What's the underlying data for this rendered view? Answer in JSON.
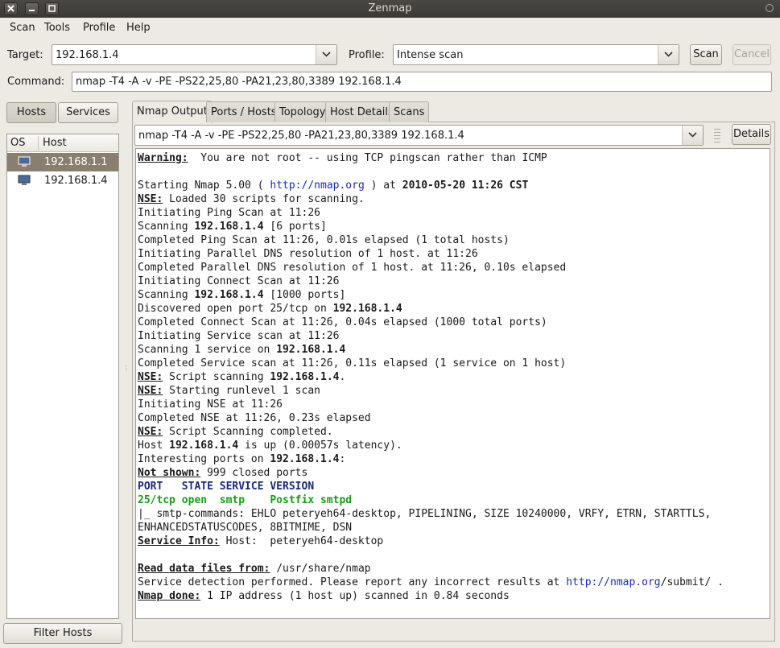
{
  "window": {
    "title": "Zenmap"
  },
  "menu": [
    "Scan",
    "Tools",
    "Profile",
    "Help"
  ],
  "target": {
    "label": "Target:",
    "value": "192.168.1.4"
  },
  "profile": {
    "label": "Profile:",
    "value": "Intense scan"
  },
  "buttons": {
    "scan": "Scan",
    "cancel": "Cancel",
    "details": "Details",
    "hosts": "Hosts",
    "services": "Services",
    "filter_hosts": "Filter Hosts"
  },
  "command": {
    "label": "Command:",
    "value": "nmap -T4 -A -v -PE -PS22,25,80 -PA21,23,80,3389 192.168.1.4"
  },
  "host_list": {
    "columns": [
      "OS",
      "Host"
    ],
    "rows": [
      "192.168.1.1",
      "192.168.1.4"
    ]
  },
  "tabs": [
    "Nmap Output",
    "Ports / Hosts",
    "Topology",
    "Host Details",
    "Scans"
  ],
  "output_selector": "nmap -T4 -A -v -PE -PS22,25,80 -PA21,23,80,3389 192.168.1.4",
  "output": [
    [
      {
        "t": "Warning:",
        "s": "b u"
      },
      {
        "t": "  You are not root -- using TCP pingscan rather than ICMP"
      }
    ],
    [],
    [
      {
        "t": "Starting Nmap 5.00 ( "
      },
      {
        "t": "http://nmap.org",
        "s": "link"
      },
      {
        "t": " ) at "
      },
      {
        "t": "2010-05-20 11:26 CST",
        "s": "b"
      }
    ],
    [
      {
        "t": "NSE:",
        "s": "b u"
      },
      {
        "t": " Loaded 30 scripts for scanning."
      }
    ],
    [
      {
        "t": "Initiating Ping Scan at 11:26"
      }
    ],
    [
      {
        "t": "Scanning "
      },
      {
        "t": "192.168.1.4",
        "s": "b"
      },
      {
        "t": " [6 ports]"
      }
    ],
    [
      {
        "t": "Completed Ping Scan at 11:26, 0.01s elapsed (1 total hosts)"
      }
    ],
    [
      {
        "t": "Initiating Parallel DNS resolution of 1 host. at 11:26"
      }
    ],
    [
      {
        "t": "Completed Parallel DNS resolution of 1 host. at 11:26, 0.10s elapsed"
      }
    ],
    [
      {
        "t": "Initiating Connect Scan at 11:26"
      }
    ],
    [
      {
        "t": "Scanning "
      },
      {
        "t": "192.168.1.4",
        "s": "b"
      },
      {
        "t": " [1000 ports]"
      }
    ],
    [
      {
        "t": "Discovered open port 25/tcp on "
      },
      {
        "t": "192.168.1.4",
        "s": "b"
      }
    ],
    [
      {
        "t": "Completed Connect Scan at 11:26, 0.04s elapsed (1000 total ports)"
      }
    ],
    [
      {
        "t": "Initiating Service scan at 11:26"
      }
    ],
    [
      {
        "t": "Scanning 1 service on "
      },
      {
        "t": "192.168.1.4",
        "s": "b"
      }
    ],
    [
      {
        "t": "Completed Service scan at 11:26, 0.11s elapsed (1 service on 1 host)"
      }
    ],
    [
      {
        "t": "NSE:",
        "s": "b u"
      },
      {
        "t": " Script scanning "
      },
      {
        "t": "192.168.1.4",
        "s": "b"
      },
      {
        "t": "."
      }
    ],
    [
      {
        "t": "NSE:",
        "s": "b u"
      },
      {
        "t": " Starting runlevel 1 scan"
      }
    ],
    [
      {
        "t": "Initiating NSE at 11:26"
      }
    ],
    [
      {
        "t": "Completed NSE at 11:26, 0.23s elapsed"
      }
    ],
    [
      {
        "t": "NSE:",
        "s": "b u"
      },
      {
        "t": " Script Scanning completed."
      }
    ],
    [
      {
        "t": "Host "
      },
      {
        "t": "192.168.1.4",
        "s": "b"
      },
      {
        "t": " is up (0.00057s latency)."
      }
    ],
    [
      {
        "t": "Interesting ports on "
      },
      {
        "t": "192.168.1.4",
        "s": "b"
      },
      {
        "t": ":"
      }
    ],
    [
      {
        "t": "Not shown:",
        "s": "b u"
      },
      {
        "t": " 999 closed ports"
      }
    ],
    [
      {
        "t": "PORT   STATE SERVICE VERSION",
        "s": "navy"
      }
    ],
    [
      {
        "t": "25/tcp open  smtp    Postfix smtpd",
        "s": "green"
      }
    ],
    [
      {
        "t": "|_ smtp-commands: EHLO peteryeh64-desktop, PIPELINING, SIZE 10240000, VRFY, ETRN, STARTTLS,"
      }
    ],
    [
      {
        "t": "ENHANCEDSTATUSCODES, 8BITMIME, DSN"
      }
    ],
    [
      {
        "t": "Service Info:",
        "s": "b u"
      },
      {
        "t": " Host:  peteryeh64-desktop"
      }
    ],
    [],
    [
      {
        "t": "Read data files from:",
        "s": "b u"
      },
      {
        "t": " /usr/share/nmap"
      }
    ],
    [
      {
        "t": "Service detection performed. Please report any incorrect results at "
      },
      {
        "t": "http://nmap.org",
        "s": "link"
      },
      {
        "t": "/submit/ ."
      }
    ],
    [
      {
        "t": "Nmap done:",
        "s": "b u"
      },
      {
        "t": " 1 IP address (1 host up) scanned in 0.84 seconds"
      }
    ]
  ]
}
